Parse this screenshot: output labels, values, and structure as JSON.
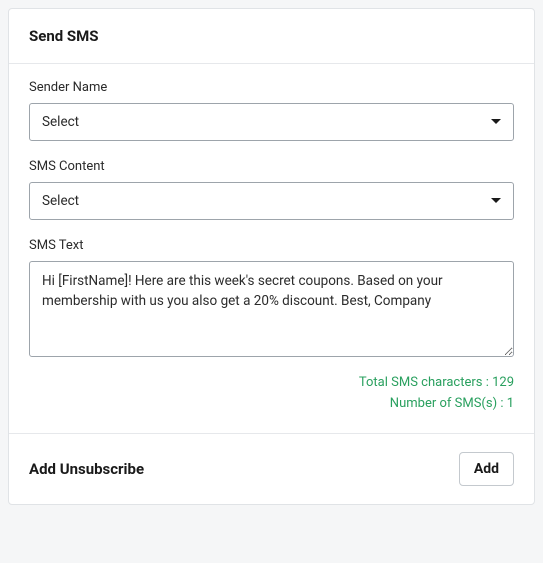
{
  "header": {
    "title": "Send SMS"
  },
  "form": {
    "senderName": {
      "label": "Sender Name",
      "selected": "Select"
    },
    "smsContent": {
      "label": "SMS Content",
      "selected": "Select"
    },
    "smsText": {
      "label": "SMS Text",
      "value": "Hi [FirstName]! Here are this week's secret coupons. Based on your membership with us you also get a 20% discount. Best, Company"
    }
  },
  "stats": {
    "charCount": "Total SMS characters : 129",
    "smsCount": "Number of SMS(s) : 1"
  },
  "footer": {
    "title": "Add Unsubscribe",
    "addButton": "Add"
  }
}
